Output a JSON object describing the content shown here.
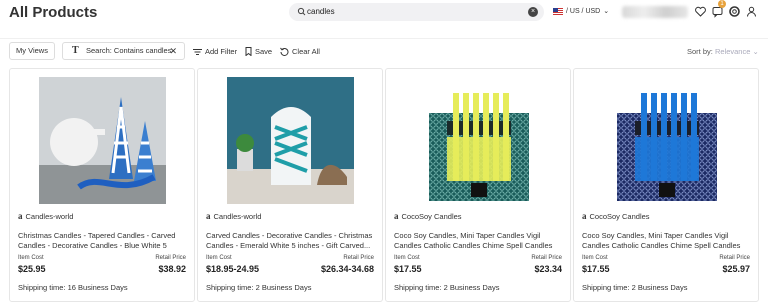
{
  "header": {
    "title": "All Products",
    "search": {
      "value": "candles"
    },
    "region": "/ US / USD",
    "notification_count": "1"
  },
  "toolbar": {
    "my_views": "My Views",
    "filter_chip": "Search: Contains candles",
    "add_filter": "Add Filter",
    "save": "Save",
    "clear_all": "Clear All",
    "sort_label": "Sort by:",
    "sort_value": "Relevance"
  },
  "products": [
    {
      "store": "Candles-world",
      "title": "Christmas Candles - Tapered Candles - Carved Candles - Decorative Candles - Blue White 5 inches ...",
      "cost_label": "Item Cost",
      "cost": "$25.95",
      "retail_label": "Retail Price",
      "retail": "$38.92",
      "shipping": "Shipping time: 16 Business Days",
      "image": "blue-white-carved-candle"
    },
    {
      "store": "Candles-world",
      "title": "Carved Candles - Decorative Candles - Christmas Candles - Emerald White 5 inches - Gift Carved...",
      "cost_label": "Item Cost",
      "cost": "$18.95-24.95",
      "retail_label": "Retail Price",
      "retail": "$26.34-34.68",
      "shipping": "Shipping time: 2 Business Days",
      "image": "emerald-carved-candle"
    },
    {
      "store": "CocoSoy Candles",
      "title": "Coco Soy Candles, Mini Taper Candles Vigil Candles Catholic Candles Chime Spell Candles Chakra Candl...",
      "cost_label": "Item Cost",
      "cost": "$17.55",
      "retail_label": "Retail Price",
      "retail": "$23.34",
      "shipping": "Shipping time: 2 Business Days",
      "image": "yellow-taper-candles-box"
    },
    {
      "store": "CocoSoy Candles",
      "title": "Coco Soy Candles, Mini Taper Candles Vigil Candles Catholic Candles Chime Spell Candles Chakra Candl...",
      "cost_label": "Item Cost",
      "cost": "$17.55",
      "retail_label": "Retail Price",
      "retail": "$25.97",
      "shipping": "Shipping time: 2 Business Days",
      "image": "blue-taper-candles-box"
    }
  ]
}
